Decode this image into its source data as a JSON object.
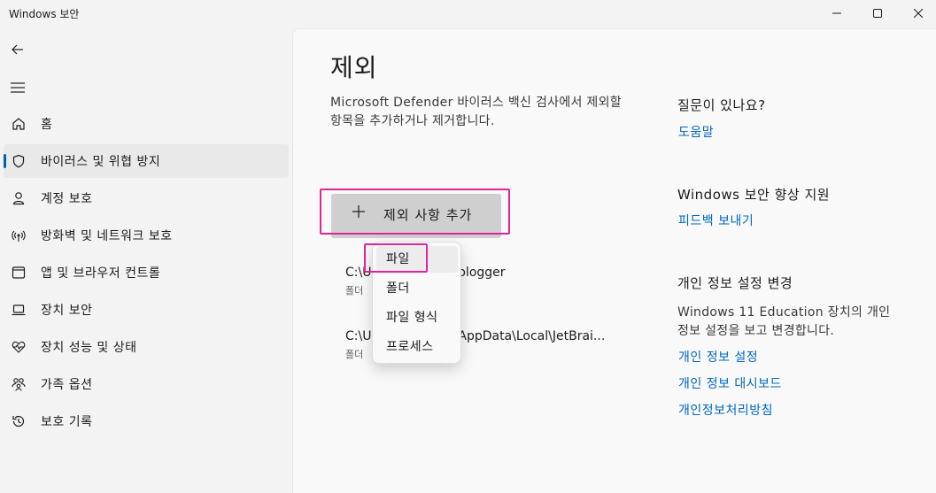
{
  "window": {
    "title": "Windows 보안"
  },
  "sidebar": {
    "items": [
      {
        "label": "홈",
        "icon": "home-icon"
      },
      {
        "label": "바이러스 및 위협 방지",
        "icon": "shield-icon",
        "selected": true
      },
      {
        "label": "계정 보호",
        "icon": "person-icon"
      },
      {
        "label": "방화벽 및 네트워크 보호",
        "icon": "wireless-icon"
      },
      {
        "label": "앱 및 브라우저 컨트롤",
        "icon": "app-window-icon"
      },
      {
        "label": "장치 보안",
        "icon": "laptop-icon"
      },
      {
        "label": "장치 성능 및 상태",
        "icon": "heart-pulse-icon"
      },
      {
        "label": "가족 옵션",
        "icon": "family-icon"
      },
      {
        "label": "보호 기록",
        "icon": "history-icon"
      }
    ]
  },
  "main": {
    "title": "제외",
    "description": "Microsoft Defender 바이러스 백신 검사에서 제외할 항목을 추가하거나 제거합니다.",
    "add_button_label": "제외 사항 추가",
    "exclusions": [
      {
        "path": "C:\\U                      ologger",
        "type": "폴더"
      },
      {
        "path": "C:\\U                      AppData\\Local\\JetBrai...",
        "type": "폴더"
      }
    ],
    "flyout": {
      "items": [
        "파일",
        "폴더",
        "파일 형식",
        "프로세스"
      ]
    }
  },
  "right_panel": {
    "help_heading": "질문이 있나요?",
    "help_link": "도움말",
    "improve_heading": "Windows 보안 향상 지원",
    "feedback_link": "피드백 보내기",
    "privacy_heading": "개인 정보 설정 변경",
    "privacy_text": "Windows 11 Education 장치의 개인 정보 설정을 보고 변경합니다.",
    "privacy_links": [
      "개인 정보 설정",
      "개인 정보 대시보드",
      "개인정보처리방침"
    ]
  },
  "colors": {
    "accent": "#005fb8",
    "link": "#0067c0",
    "highlight_box": "#e0259a"
  }
}
